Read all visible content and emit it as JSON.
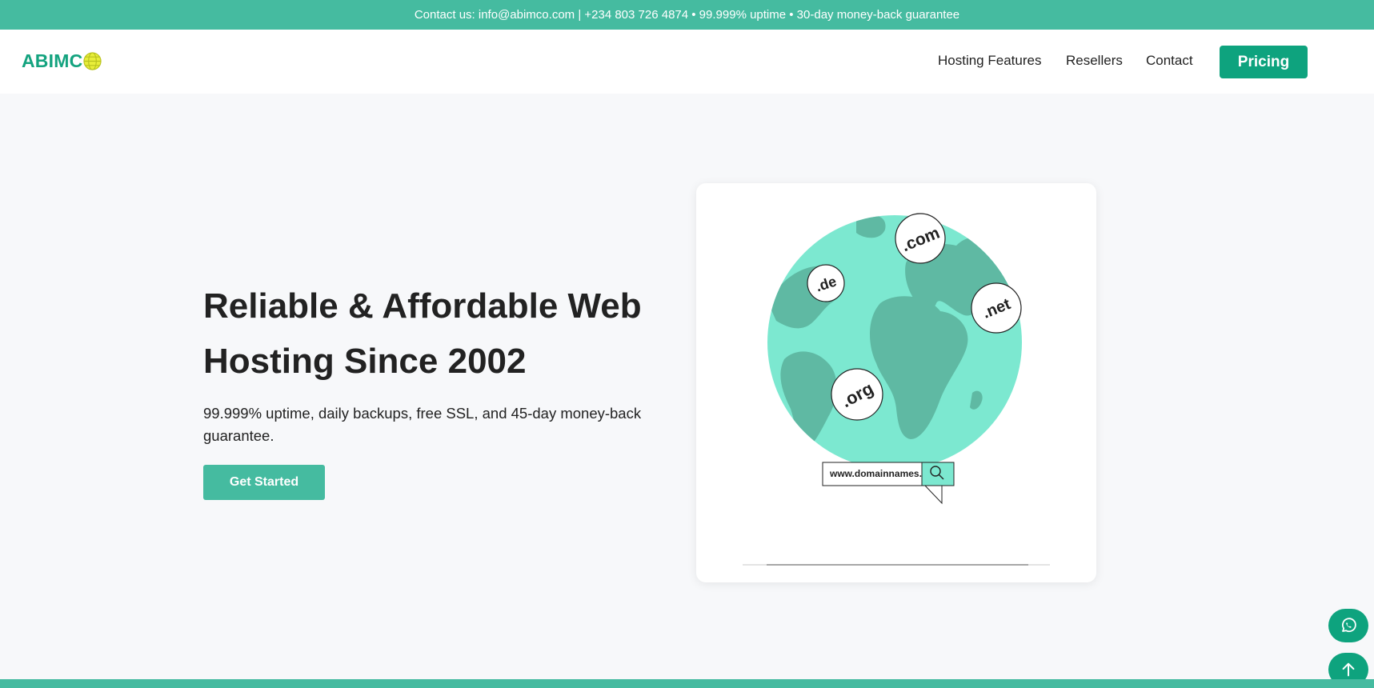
{
  "topbar": {
    "text": "Contact us: info@abimco.com | +234 803 726 4874 • 99.999% uptime • 30-day money-back guarantee"
  },
  "brand": {
    "name": "ABIMC",
    "logo_icon": "globe-icon",
    "accent": "#14a37f",
    "globe_color": "#e8ee3a"
  },
  "nav": {
    "items": [
      {
        "label": "Hosting Features"
      },
      {
        "label": "Resellers"
      },
      {
        "label": "Contact"
      }
    ],
    "cta_label": "Pricing"
  },
  "hero": {
    "title": "Reliable & Affordable Web Hosting Since 2002",
    "subtitle": "99.999% uptime, daily backups, free SSL, and 45-day money-back guarantee.",
    "cta_label": "Get Started"
  },
  "illustration": {
    "domains": [
      ".com",
      ".de",
      ".net",
      ".org"
    ],
    "search_text": "www.domainnames.",
    "search_icon": "magnifier-icon"
  },
  "floating": {
    "whatsapp_icon": "whatsapp-icon",
    "top_icon": "arrow-up-icon"
  },
  "colors": {
    "primary": "#45bba0",
    "primary_dark": "#0ea37e",
    "globe_water": "#7ce8d0",
    "globe_land": "#5fb9a3",
    "background": "#f7f8fa"
  }
}
